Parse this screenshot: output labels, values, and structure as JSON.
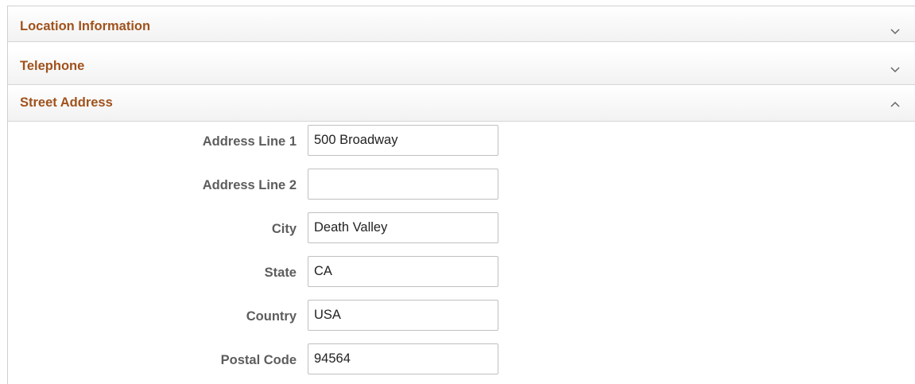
{
  "sections": [
    {
      "title": "Location Information",
      "state": "collapsed",
      "icon": "chevron-down-icon"
    },
    {
      "title": "Telephone",
      "state": "collapsed",
      "icon": "chevron-down-icon"
    },
    {
      "title": "Street Address",
      "state": "expanded",
      "icon": "chevron-up-icon"
    }
  ],
  "address": {
    "fields": [
      {
        "label": "Address Line 1",
        "value": "500 Broadway"
      },
      {
        "label": "Address Line 2",
        "value": ""
      },
      {
        "label": "City",
        "value": "Death Valley"
      },
      {
        "label": "State",
        "value": "CA"
      },
      {
        "label": "Country",
        "value": "USA"
      },
      {
        "label": "Postal Code",
        "value": "94564"
      }
    ]
  },
  "colors": {
    "section_title": "#a0521c",
    "label": "#5d5d5d",
    "header_border": "#d6d6d6"
  }
}
